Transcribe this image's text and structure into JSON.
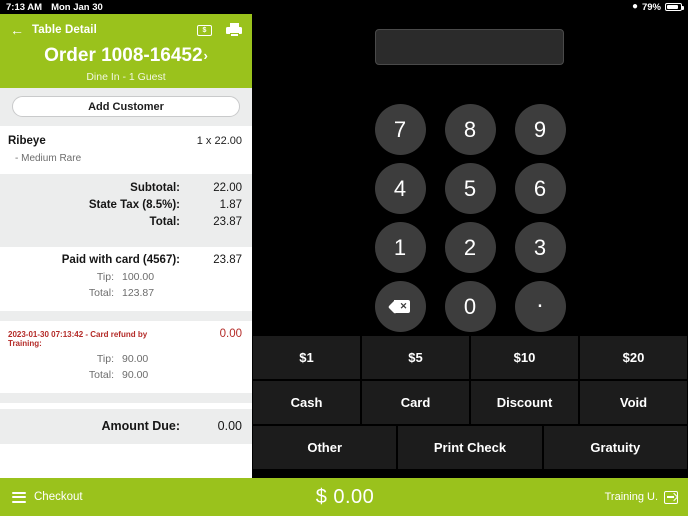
{
  "statusbar": {
    "time": "7:13 AM",
    "date": "Mon Jan 30",
    "wifi_icon": "wifi-icon",
    "battery_percent": "79%",
    "battery_icon": "battery-icon"
  },
  "order_header": {
    "back_label": "Table Detail",
    "back_icon": "back-arrow-icon",
    "cash_icon": "cash-bill-icon",
    "print_icon": "printer-icon",
    "order_number": "Order 1008-16452",
    "chevron": "›",
    "subtitle": "Dine In - 1 Guest",
    "bg_color": "#9ac21c"
  },
  "add_customer": {
    "label": "Add Customer"
  },
  "items": [
    {
      "name": "Ribeye",
      "qty_price": "1 x 22.00",
      "modifier": "- Medium Rare"
    }
  ],
  "totals": [
    {
      "label": "Subtotal:",
      "value": "22.00"
    },
    {
      "label": "State Tax (8.5%):",
      "value": "1.87"
    },
    {
      "label": "Total:",
      "value": "23.87"
    }
  ],
  "payment": {
    "title": "Paid with card (4567):",
    "amount": "23.87",
    "lines": [
      {
        "label": "Tip:",
        "value": "100.00"
      },
      {
        "label": "Total:",
        "value": "123.87"
      }
    ]
  },
  "refund": {
    "title": "2023-01-30 07:13:42 - Card refund by Training:",
    "amount": "0.00",
    "color": "#b42b28",
    "lines": [
      {
        "label": "Tip:",
        "value": "90.00"
      },
      {
        "label": "Total:",
        "value": "90.00"
      }
    ]
  },
  "amount_due": {
    "label": "Amount Due:",
    "value": "0.00"
  },
  "keypad": {
    "display_value": "",
    "keys": [
      {
        "label": "7",
        "name": "key-7",
        "type": "digit"
      },
      {
        "label": "8",
        "name": "key-8",
        "type": "digit"
      },
      {
        "label": "9",
        "name": "key-9",
        "type": "digit"
      },
      {
        "label": "4",
        "name": "key-4",
        "type": "digit"
      },
      {
        "label": "5",
        "name": "key-5",
        "type": "digit"
      },
      {
        "label": "6",
        "name": "key-6",
        "type": "digit"
      },
      {
        "label": "1",
        "name": "key-1",
        "type": "digit"
      },
      {
        "label": "2",
        "name": "key-2",
        "type": "digit"
      },
      {
        "label": "3",
        "name": "key-3",
        "type": "digit"
      },
      {
        "label": "",
        "name": "key-backspace",
        "type": "backspace"
      },
      {
        "label": "0",
        "name": "key-0",
        "type": "digit"
      },
      {
        "label": ".",
        "name": "key-decimal",
        "type": "dot"
      }
    ]
  },
  "actions": {
    "row1": [
      {
        "label": "$1",
        "name": "quick-amount-1"
      },
      {
        "label": "$5",
        "name": "quick-amount-5"
      },
      {
        "label": "$10",
        "name": "quick-amount-10"
      },
      {
        "label": "$20",
        "name": "quick-amount-20"
      }
    ],
    "row2": [
      {
        "label": "Cash",
        "name": "cash-button"
      },
      {
        "label": "Card",
        "name": "card-button"
      },
      {
        "label": "Discount",
        "name": "discount-button"
      },
      {
        "label": "Void",
        "name": "void-button"
      }
    ],
    "row3": [
      {
        "label": "Other",
        "name": "other-button"
      },
      {
        "label": "Print Check",
        "name": "print-check-button"
      },
      {
        "label": "Gratuity",
        "name": "gratuity-button"
      }
    ]
  },
  "bottombar": {
    "menu_icon": "hamburger-menu-icon",
    "checkout_label": "Checkout",
    "amount": "$ 0.00",
    "user": "Training U.",
    "logout_icon": "logout-icon",
    "bg_color": "#9ac21c"
  }
}
